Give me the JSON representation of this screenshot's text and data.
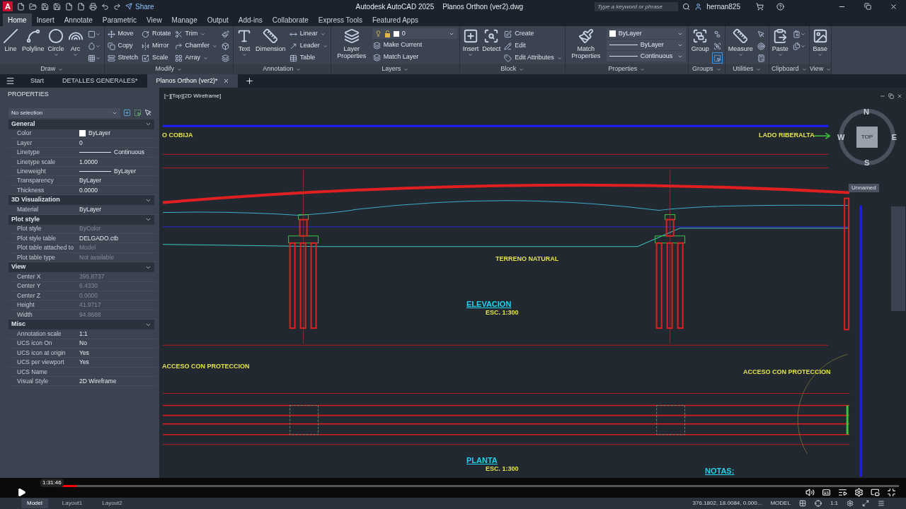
{
  "title_bar": {
    "logo": "A",
    "share": "Share",
    "app_title": "Autodesk AutoCAD 2025",
    "file_name": "Planos Orthon (ver2).dwg",
    "search": {
      "placeholder": "Type a keyword or phrase"
    },
    "user": "hernan825"
  },
  "ribbon_tabs": [
    {
      "label": "Home",
      "selected": true
    },
    {
      "label": "Insert",
      "selected": false
    },
    {
      "label": "Annotate",
      "selected": false
    },
    {
      "label": "Parametric",
      "selected": false
    },
    {
      "label": "View",
      "selected": false
    },
    {
      "label": "Manage",
      "selected": false
    },
    {
      "label": "Output",
      "selected": false
    },
    {
      "label": "Add-ins",
      "selected": false
    },
    {
      "label": "Collaborate",
      "selected": false
    },
    {
      "label": "Express Tools",
      "selected": false
    },
    {
      "label": "Featured Apps",
      "selected": false
    }
  ],
  "ribbon_panels": [
    {
      "title": "Draw",
      "columns": [
        {
          "kind": "large",
          "label": "Line",
          "menu": false
        },
        {
          "kind": "large",
          "label": "Polyline",
          "menu": false
        },
        {
          "kind": "large",
          "label": "Circle",
          "menu": true
        },
        {
          "kind": "large",
          "label": "Arc",
          "menu": true
        },
        {
          "kind": "stack",
          "items": [
            {
              "kind": "icon",
              "menu": true,
              "on": false
            },
            {
              "kind": "icon",
              "menu": true,
              "on": false
            },
            {
              "kind": "icon",
              "menu": true,
              "on": false
            }
          ]
        }
      ]
    },
    {
      "title": "Modify",
      "columns": [
        {
          "kind": "stack",
          "items": [
            {
              "kind": "small",
              "label": "Move",
              "menu": false
            },
            {
              "kind": "small",
              "label": "Copy",
              "menu": false
            },
            {
              "kind": "small",
              "label": "Stretch",
              "menu": false
            }
          ]
        },
        {
          "kind": "stack",
          "items": [
            {
              "kind": "small",
              "label": "Rotate",
              "menu": false
            },
            {
              "kind": "small",
              "label": "Mirror",
              "menu": false
            },
            {
              "kind": "small",
              "label": "Scale",
              "menu": false
            }
          ]
        },
        {
          "kind": "stack",
          "items": [
            {
              "kind": "small",
              "label": "Trim",
              "menu": true
            },
            {
              "kind": "small",
              "label": "Chamfer",
              "menu": true
            },
            {
              "kind": "small",
              "label": "Array",
              "menu": true
            }
          ]
        },
        {
          "kind": "stack",
          "items": [
            {
              "kind": "icon",
              "menu": false,
              "on": false
            },
            {
              "kind": "icon",
              "menu": false,
              "on": false
            },
            {
              "kind": "icon",
              "menu": false,
              "on": false
            }
          ]
        }
      ]
    },
    {
      "title": "Annotation",
      "columns": [
        {
          "kind": "large",
          "label": "Text",
          "menu": true
        },
        {
          "kind": "large",
          "label": "Dimension",
          "menu": false
        },
        {
          "kind": "stack",
          "items": [
            {
              "kind": "small",
              "label": "Linear",
              "menu": true
            },
            {
              "kind": "small",
              "label": "Leader",
              "menu": true
            },
            {
              "kind": "small",
              "label": "Table",
              "menu": false
            }
          ]
        }
      ]
    },
    {
      "title": "Layers",
      "columns": [
        {
          "kind": "large",
          "label": "Layer Properties",
          "menu": false
        },
        {
          "kind": "stack",
          "items": [
            {
              "kind": "layer-dropdown",
              "label": "0"
            },
            {
              "kind": "small",
              "label": "Make Current",
              "menu": false
            },
            {
              "kind": "small",
              "label": "Match Layer",
              "menu": false
            }
          ]
        }
      ]
    },
    {
      "title": "Block",
      "columns": [
        {
          "kind": "large",
          "label": "Insert",
          "menu": true
        },
        {
          "kind": "large",
          "label": "Detect",
          "menu": false
        },
        {
          "kind": "stack",
          "items": [
            {
              "kind": "small",
              "label": "Create",
              "menu": false
            },
            {
              "kind": "small",
              "label": "Edit",
              "menu": false
            },
            {
              "kind": "small",
              "label": "Edit Attributes",
              "menu": true
            }
          ]
        }
      ]
    },
    {
      "title": "Properties",
      "columns": [
        {
          "kind": "large",
          "label": "Match Properties",
          "menu": false
        },
        {
          "kind": "stack",
          "items": [
            {
              "kind": "color-dropdown",
              "label": "ByLayer"
            },
            {
              "kind": "line-dropdown",
              "label": "ByLayer"
            },
            {
              "kind": "line-dropdown",
              "label": "Continuous"
            }
          ]
        }
      ]
    },
    {
      "title": "Groups",
      "columns": [
        {
          "kind": "large",
          "label": "Group",
          "menu": false
        },
        {
          "kind": "stack",
          "items": [
            {
              "kind": "icon",
              "menu": false,
              "on": false
            },
            {
              "kind": "icon",
              "menu": false,
              "on": false
            },
            {
              "kind": "icon",
              "menu": false,
              "on": true
            }
          ]
        }
      ]
    },
    {
      "title": "Utilities",
      "columns": [
        {
          "kind": "large",
          "label": "Measure",
          "menu": true
        },
        {
          "kind": "stack",
          "items": [
            {
              "kind": "icon",
              "menu": false,
              "on": false
            },
            {
              "kind": "icon",
              "menu": false,
              "on": false
            },
            {
              "kind": "icon",
              "menu": false,
              "on": false
            }
          ]
        }
      ]
    },
    {
      "title": "Clipboard",
      "columns": [
        {
          "kind": "large",
          "label": "Paste",
          "menu": true
        },
        {
          "kind": "stack",
          "items": [
            {
              "kind": "icon",
              "menu": true,
              "on": false
            },
            {
              "kind": "icon",
              "menu": true,
              "on": false
            }
          ]
        }
      ]
    },
    {
      "title": "View",
      "columns": [
        {
          "kind": "large",
          "label": "Base",
          "menu": true
        }
      ]
    }
  ],
  "file_tabs": [
    {
      "label": "Start",
      "selected": false,
      "closable": false
    },
    {
      "label": "DETALLES GENERALES*",
      "selected": false,
      "closable": false
    },
    {
      "label": "Planos Orthon (ver2)*",
      "selected": true,
      "closable": true
    }
  ],
  "properties_palette": {
    "title": "PROPERTIES",
    "selection": "No selection",
    "sections": [
      {
        "title": "General",
        "expanded": true,
        "rows": [
          {
            "label": "Color",
            "value": "ByLayer",
            "kind": "swatch",
            "disabled": false
          },
          {
            "label": "Layer",
            "value": "0",
            "kind": "text",
            "disabled": false
          },
          {
            "label": "Linetype",
            "value": "Continuous",
            "kind": "line",
            "disabled": false
          },
          {
            "label": "Linetype scale",
            "value": "1.0000",
            "kind": "text",
            "disabled": false
          },
          {
            "label": "Lineweight",
            "value": "ByLayer",
            "kind": "line",
            "disabled": false
          },
          {
            "label": "Transparency",
            "value": "ByLayer",
            "kind": "text",
            "disabled": false
          },
          {
            "label": "Thickness",
            "value": "0.0000",
            "kind": "text",
            "disabled": false
          }
        ]
      },
      {
        "title": "3D Visualization",
        "expanded": true,
        "rows": [
          {
            "label": "Material",
            "value": "ByLayer",
            "kind": "text",
            "disabled": false
          }
        ]
      },
      {
        "title": "Plot style",
        "expanded": true,
        "rows": [
          {
            "label": "Plot style",
            "value": "ByColor",
            "kind": "text",
            "disabled": true
          },
          {
            "label": "Plot style table",
            "value": "DELGADO.ctb",
            "kind": "text",
            "disabled": false
          },
          {
            "label": "Plot table attached to",
            "value": "Model",
            "kind": "text",
            "disabled": true
          },
          {
            "label": "Plot table type",
            "value": "Not available",
            "kind": "text",
            "disabled": true
          }
        ]
      },
      {
        "title": "View",
        "expanded": true,
        "rows": [
          {
            "label": "Center X",
            "value": "395.8737",
            "kind": "text",
            "disabled": true
          },
          {
            "label": "Center Y",
            "value": "6.4330",
            "kind": "text",
            "disabled": true
          },
          {
            "label": "Center Z",
            "value": "0.0000",
            "kind": "text",
            "disabled": true
          },
          {
            "label": "Height",
            "value": "41.9717",
            "kind": "text",
            "disabled": true
          },
          {
            "label": "Width",
            "value": "94.8688",
            "kind": "text",
            "disabled": true
          }
        ]
      },
      {
        "title": "Misc",
        "expanded": true,
        "rows": [
          {
            "label": "Annotation scale",
            "value": "1:1",
            "kind": "text",
            "disabled": false
          },
          {
            "label": "UCS icon On",
            "value": "No",
            "kind": "text",
            "disabled": false
          },
          {
            "label": "UCS icon at origin",
            "value": "Yes",
            "kind": "text",
            "disabled": false
          },
          {
            "label": "UCS per viewport",
            "value": "Yes",
            "kind": "text",
            "disabled": false
          },
          {
            "label": "UCS Name",
            "value": "",
            "kind": "text",
            "disabled": false
          },
          {
            "label": "Visual Style",
            "value": "2D Wireframe",
            "kind": "text",
            "disabled": false
          }
        ]
      }
    ]
  },
  "viewport": {
    "label": "[−][Top][2D Wireframe]",
    "drawing_texts": [
      {
        "text": "O COBIJA",
        "color": "#e3e34a"
      },
      {
        "text": "LADO RIBERALTA",
        "color": "#e3e34a"
      },
      {
        "text": "TERRENO NATURAL",
        "color": "#e3e34a"
      },
      {
        "text": "ELEVACION",
        "color": "#22d3ee"
      },
      {
        "text": "ESC. 1:300",
        "color": "#e3e34a"
      },
      {
        "text": "ACCESO CON PROTECCION",
        "color": "#e3e34a"
      },
      {
        "text": "ACCESO CON PROTECCION",
        "color": "#e3e34a"
      },
      {
        "text": "PLANTA",
        "color": "#22d3ee"
      },
      {
        "text": "ESC. 1:300",
        "color": "#e3e34a"
      },
      {
        "text": "NOTAS:",
        "color": "#22d3ee"
      }
    ],
    "viewcube": {
      "north": "N",
      "south": "S",
      "east": "E",
      "west": "W",
      "face": "TOP",
      "ucs": "Unnamed"
    }
  },
  "video_player": {
    "time": "1:31:46",
    "level": 0.04
  },
  "status_bar": {
    "layout_tabs": [
      {
        "label": "Model",
        "selected": true
      },
      {
        "label": "Layout1",
        "selected": false
      },
      {
        "label": "Layout2",
        "selected": false
      }
    ],
    "coordinates": "376.1802, 18.0084, 0.000...",
    "space": "MODEL",
    "scale": "1:1"
  }
}
